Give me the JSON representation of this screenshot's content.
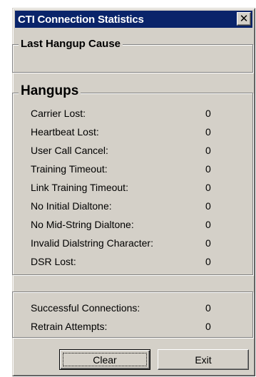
{
  "window": {
    "title": "CTI Connection Statistics",
    "close_glyph": "✕"
  },
  "last_hangup": {
    "title": "Last Hangup Cause",
    "value": ""
  },
  "hangups": {
    "title": "Hangups",
    "rows": [
      {
        "label": "Carrier Lost:",
        "value": "0"
      },
      {
        "label": "Heartbeat Lost:",
        "value": "0"
      },
      {
        "label": "User Call Cancel:",
        "value": "0"
      },
      {
        "label": "Training Timeout:",
        "value": "0"
      },
      {
        "label": "Link Training Timeout:",
        "value": "0"
      },
      {
        "label": "No Initial Dialtone:",
        "value": "0"
      },
      {
        "label": "No Mid-String Dialtone:",
        "value": "0"
      },
      {
        "label": "Invalid Dialstring Character:",
        "value": "0"
      },
      {
        "label": "DSR Lost:",
        "value": "0"
      }
    ]
  },
  "connections": {
    "rows": [
      {
        "label": "Successful Connections:",
        "value": "0"
      },
      {
        "label": "Retrain Attempts:",
        "value": "0"
      }
    ]
  },
  "buttons": {
    "clear": "Clear",
    "exit": "Exit"
  }
}
